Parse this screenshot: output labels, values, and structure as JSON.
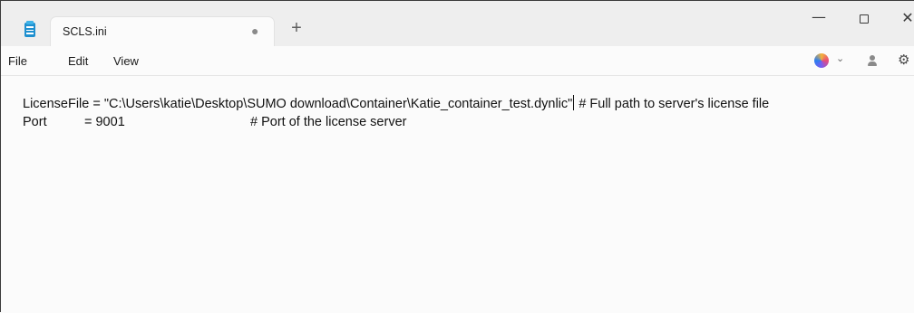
{
  "tab": {
    "title": "SCLS.ini",
    "modified_indicator": "●",
    "new_tab_label": "+"
  },
  "window_controls": {
    "minimize": "—",
    "close": "✕"
  },
  "menu": {
    "file": "File",
    "edit": "Edit",
    "view": "View"
  },
  "toolbar_icons": {
    "copilot": "copilot-icon",
    "chevron": "⌄",
    "account": "account-icon",
    "settings": "⚙"
  },
  "editor": {
    "line1_before_caret": "LicenseFile = \"C:\\Users\\katie\\Desktop\\SUMO download\\Container\\Katie_container_test.dynlic\"",
    "line1_after_caret": " # Full path to server's license file",
    "line2_key": "Port",
    "line2_value": "= 9001",
    "line2_comment": "# Port of the license server"
  },
  "colors": {
    "titlebar_bg": "#eeeeee",
    "editor_bg": "#fbfbfb",
    "app_icon": "#1e8fcf"
  }
}
